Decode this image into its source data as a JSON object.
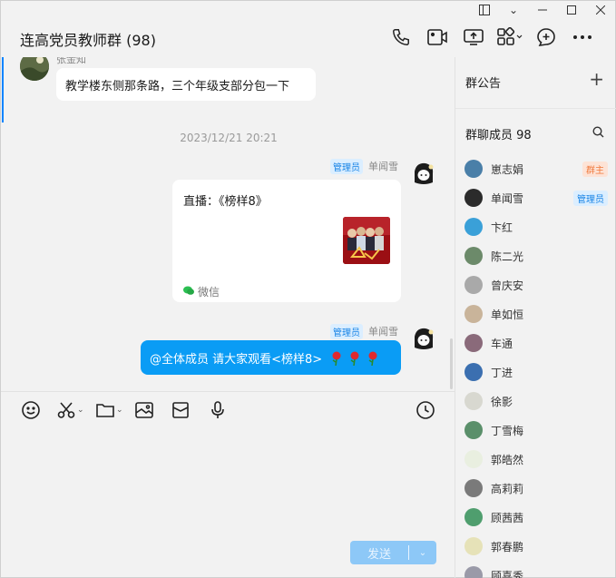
{
  "window": {
    "title": "连高党员教师群 (98)"
  },
  "messages": {
    "m1_sender": "张金知",
    "m1_text": "教学楼东侧那条路，三个年级支部分包一下",
    "timestamp": "2023/12/21 20:21",
    "m2_badge": "管理员",
    "m2_sender": "单闻雪",
    "m2_card_title": "直播：《榜样8》",
    "m2_card_source": "微信",
    "m3_badge": "管理员",
    "m3_sender": "单闻雪",
    "m3_text": "@全体成员 请大家观看<榜样8>"
  },
  "composer": {
    "send_label": "发送"
  },
  "sidebar": {
    "announcement_label": "群公告",
    "members_label": "群聊成员 98",
    "members": [
      {
        "name": "崽志娟",
        "role": "群主",
        "role_type": "owner",
        "color": "#4a7fa8"
      },
      {
        "name": "单闻雪",
        "role": "管理员",
        "role_type": "admin",
        "color": "#2b2b2b"
      },
      {
        "name": "卞红",
        "role": "",
        "color": "#3aa0d8"
      },
      {
        "name": "陈二光",
        "role": "",
        "color": "#6c8a6a"
      },
      {
        "name": "曾庆安",
        "role": "",
        "color": "#a9a9a9"
      },
      {
        "name": "单如恒",
        "role": "",
        "color": "#c9b49a"
      },
      {
        "name": "车通",
        "role": "",
        "color": "#8a6a7a"
      },
      {
        "name": "丁进",
        "role": "",
        "color": "#3b6fb0"
      },
      {
        "name": "徐影",
        "role": "",
        "color": "#d8d8d0"
      },
      {
        "name": "丁雪梅",
        "role": "",
        "color": "#5a8f6a"
      },
      {
        "name": "郭皓然",
        "role": "",
        "color": "#e9efe0"
      },
      {
        "name": "高莉莉",
        "role": "",
        "color": "#7a7a7a"
      },
      {
        "name": "顾茜茜",
        "role": "",
        "color": "#4f9e6e"
      },
      {
        "name": "郭春鹏",
        "role": "",
        "color": "#e6e2b8"
      },
      {
        "name": "顾喜秀",
        "role": "",
        "color": "#9a9aa8"
      }
    ]
  }
}
